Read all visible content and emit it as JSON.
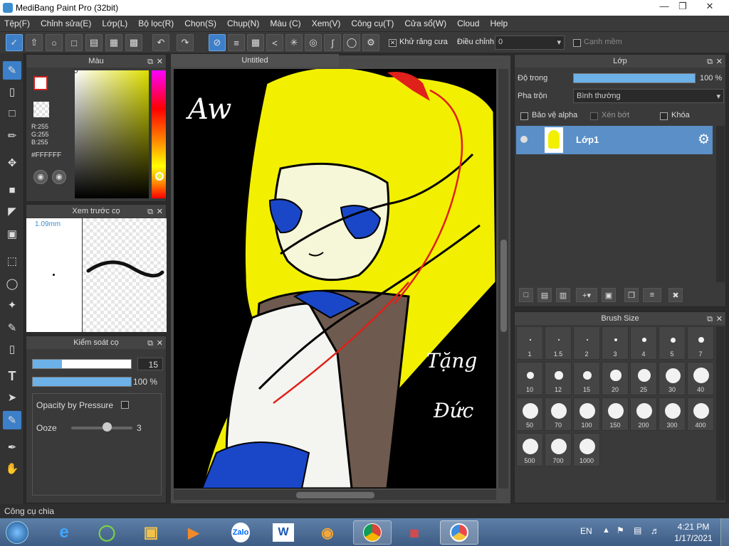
{
  "window": {
    "title": "MediBang Paint Pro (32bit)"
  },
  "menu": [
    "Tệp(F)",
    "Chỉnh sửa(E)",
    "Lớp(L)",
    "Bộ lọc(R)",
    "Chọn(S)",
    "Chụp(N)",
    "Màu (C)",
    "Xem(V)",
    "Công cụ(T)",
    "Cửa sổ(W)",
    "Cloud",
    "Help"
  ],
  "toolbar": {
    "antialias_label": "Khử răng cưa",
    "adjust_label": "Điều chỉnh",
    "adjust_value": "0",
    "soft_edge_label": "Cạnh mềm"
  },
  "color_panel": {
    "title": "Màu",
    "r": "R:255",
    "g": "G:255",
    "b": "B:255",
    "hex": "#FFFFFF"
  },
  "brush_preview": {
    "title": "Xem trước cọ",
    "size": "1.09mm"
  },
  "brush_control": {
    "title": "Kiểm soát cọ",
    "size_value": "15",
    "opacity_value": "100 %",
    "opacity_by_pressure": "Opacity by Pressure",
    "ooze_label": "Ooze",
    "ooze_value": "3"
  },
  "canvas": {
    "tab": "Untitled"
  },
  "layer_panel": {
    "title": "Lớp",
    "opacity_label": "Độ trong",
    "opacity_value": "100 %",
    "blend_label": "Pha trộn",
    "blend_value": "Bình thường",
    "protect_alpha": "Bảo vệ alpha",
    "clip": "Xén bớt",
    "lock": "Khóa",
    "layer_name": "Lớp1"
  },
  "brush_size": {
    "title": "Brush Size",
    "sizes": [
      "1",
      "1.5",
      "2",
      "3",
      "4",
      "5",
      "7",
      "10",
      "12",
      "15",
      "20",
      "25",
      "30",
      "40",
      "50",
      "70",
      "100",
      "150",
      "200",
      "300",
      "400",
      "500",
      "700",
      "1000"
    ]
  },
  "status": "Công cụ chia",
  "taskbar": {
    "lang": "EN",
    "time": "4:21 PM",
    "date": "1/17/2021",
    "zalo": "Zalo",
    "word": "W"
  }
}
